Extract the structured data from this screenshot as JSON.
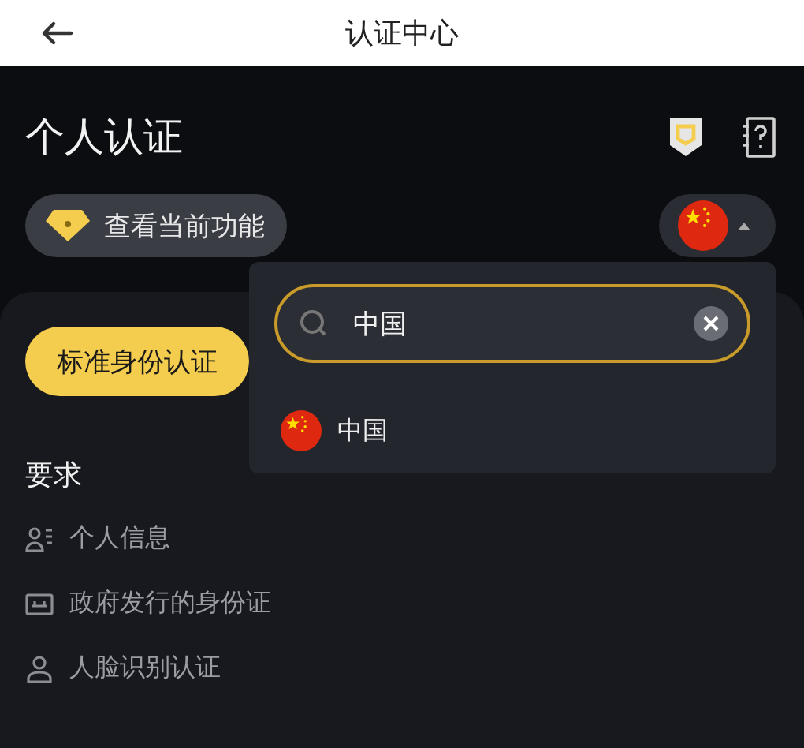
{
  "header": {
    "title": "认证中心"
  },
  "page_title": "个人认证",
  "features_chip": {
    "label": "查看当前功能"
  },
  "country_selector": {
    "expanded": true
  },
  "primary_button": {
    "label": "标准身份认证"
  },
  "requirements": {
    "title": "要求",
    "items": [
      {
        "kind": "person-info",
        "label": "个人信息"
      },
      {
        "kind": "id-card",
        "label": "政府发行的身份证"
      },
      {
        "kind": "face",
        "label": "人脸识别认证"
      }
    ]
  },
  "country_dropdown": {
    "search": {
      "value": "中国"
    },
    "results": [
      {
        "label": "中国"
      }
    ]
  }
}
